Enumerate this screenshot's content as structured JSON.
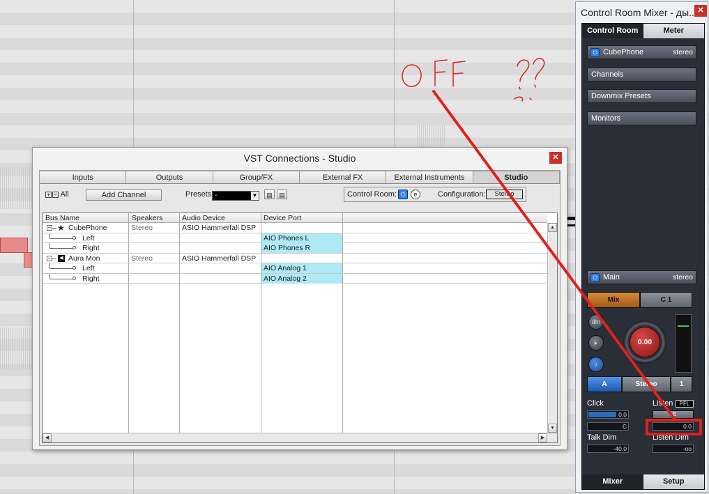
{
  "vst_window": {
    "title": "VST Connections - Studio",
    "tabs": [
      {
        "label": "Inputs",
        "active": false
      },
      {
        "label": "Outputs",
        "active": false
      },
      {
        "label": "Group/FX",
        "active": false
      },
      {
        "label": "External FX",
        "active": false
      },
      {
        "label": "External Instruments",
        "active": false
      },
      {
        "label": "Studio",
        "active": true
      }
    ],
    "toolbar": {
      "expand_all_label": "All",
      "add_channel_label": "Add Channel",
      "presets_label": "Presets",
      "presets_value": "-",
      "control_room_label": "Control Room:",
      "configuration_label": "Configuration:",
      "configuration_value": "Stereo"
    },
    "table": {
      "headers": [
        "Bus Name",
        "Speakers",
        "Audio Device",
        "Device Port"
      ],
      "rows": [
        {
          "name": "CubePhone",
          "icon": "star-icon",
          "speakers": "Stereo",
          "device": "ASIO Hammerfall DSP",
          "port": ""
        },
        {
          "name": "Left",
          "speakers": "",
          "device": "",
          "port": "AIO Phones L"
        },
        {
          "name": "Right",
          "speakers": "",
          "device": "",
          "port": "AIO Phones R"
        },
        {
          "name": "Aura Mon",
          "icon": "speaker-icon",
          "speakers": "Stereo",
          "device": "ASIO Hammerfall DSP",
          "port": ""
        },
        {
          "name": "Left",
          "speakers": "",
          "device": "",
          "port": "AIO Analog 1"
        },
        {
          "name": "Right",
          "speakers": "",
          "device": "",
          "port": "AIO Analog 2"
        }
      ]
    }
  },
  "crm_window": {
    "title": "Control Room Mixer - ды...",
    "tabs": [
      {
        "label": "Control Room",
        "active": true
      },
      {
        "label": "Meter",
        "active": false
      }
    ],
    "cubephone": {
      "label": "CubePhone",
      "format": "stereo"
    },
    "channels_label": "Channels",
    "downmix_label": "Downmix Presets",
    "monitors_label": "Monitors",
    "main": {
      "label": "Main",
      "format": "stereo"
    },
    "mix_label": "Mix",
    "c1_label": "C 1",
    "knob_value": "0.00",
    "a_label": "A",
    "stereo_label": "Stereo",
    "one_label": "1",
    "click_label": "Click",
    "click_value": "0.0",
    "click_pan": "C",
    "listen_label": "Listen",
    "pfl_label": "PFL",
    "le_label": "LE",
    "listen_value": "0.0",
    "talk_dim_label": "Talk Dim",
    "talk_dim_value": "-40.0",
    "listen_dim_label": "Listen Dim",
    "listen_dim_value": "-oo",
    "bottom_tabs": [
      {
        "label": "Mixer",
        "active": true
      },
      {
        "label": "Setup",
        "active": false
      }
    ]
  },
  "annotation": {
    "color": "#e0201c"
  }
}
